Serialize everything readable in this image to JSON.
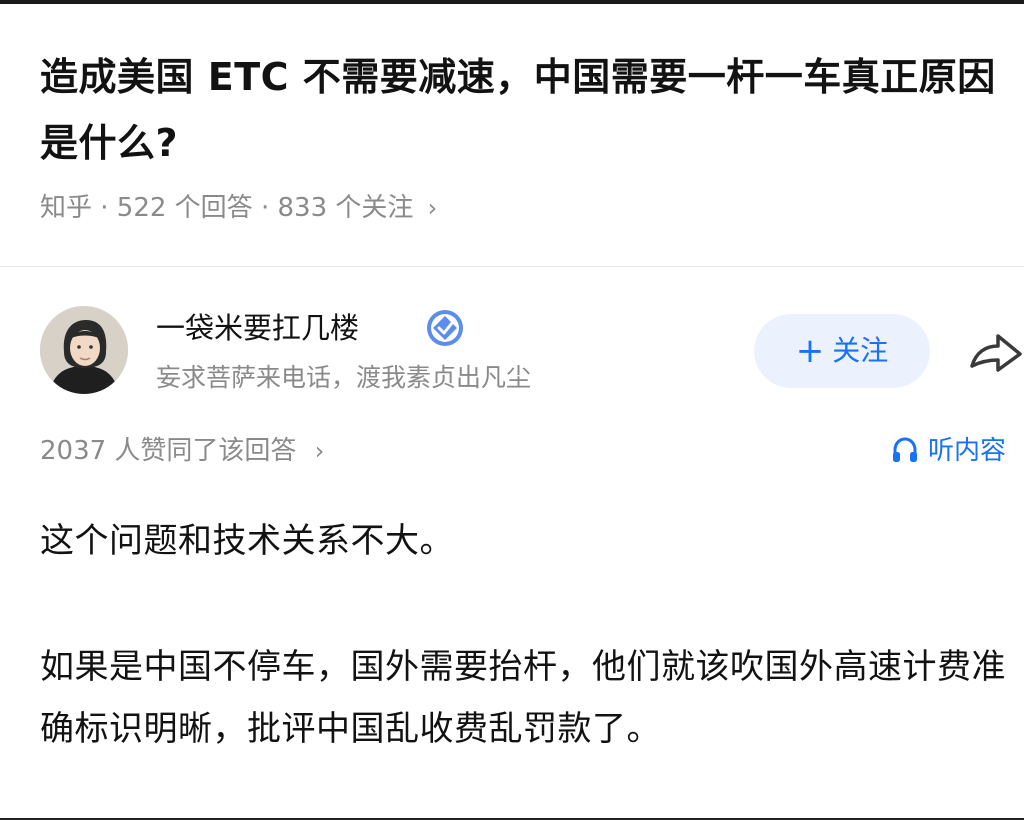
{
  "question": {
    "title": "造成美国 ETC 不需要减速，中国需要一杆一车真正原因是什么?",
    "meta": "知乎 · 522 个回答 · 833 个关注",
    "meta_chevron": "›"
  },
  "author": {
    "name": "一袋米要扛几楼",
    "bio": "妄求菩萨来电话，渡我素贞出凡尘",
    "avatar_icon": "user-avatar-photo",
    "badge_icon": "verified-badge-icon",
    "badge_color": "#5b8def"
  },
  "actions": {
    "follow_plus": "+",
    "follow_label": "关注",
    "share_icon": "share-arrow-icon",
    "accent_color": "#1772f6"
  },
  "answer": {
    "upvotes_text": "2037 人赞同了该回答",
    "upvotes_chevron": "›",
    "listen_label": "听内容",
    "listen_icon": "headphones-icon",
    "paragraphs": [
      "这个问题和技术关系不大。",
      "如果是中国不停车，国外需要抬杆，他们就该吹国外高速计费准确标识明晰，批评中国乱收费乱罚款了。"
    ]
  }
}
